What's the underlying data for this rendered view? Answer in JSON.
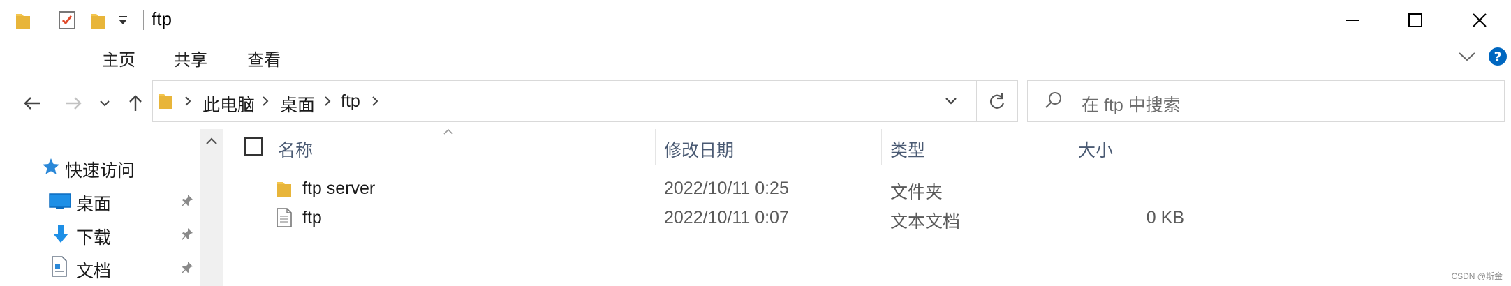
{
  "window": {
    "title": "ftp"
  },
  "ribbon": {
    "tabs": [
      "主页",
      "共享",
      "查看"
    ]
  },
  "address": {
    "crumbs": [
      "此电脑",
      "桌面",
      "ftp"
    ]
  },
  "search": {
    "placeholder": "在 ftp 中搜索"
  },
  "nav": {
    "quick_access": "快速访问",
    "items": [
      "桌面",
      "下载",
      "文档"
    ]
  },
  "columns": {
    "name": "名称",
    "date": "修改日期",
    "type": "类型",
    "size": "大小"
  },
  "files": [
    {
      "name": "ftp server",
      "date": "2022/10/11 0:25",
      "type": "文件夹",
      "size": "",
      "icon": "folder-icon"
    },
    {
      "name": "ftp",
      "date": "2022/10/11 0:07",
      "type": "文本文档",
      "size": "0 KB",
      "icon": "text-file-icon"
    }
  ],
  "watermark": "CSDN @斯金",
  "colors": {
    "folder": "#f4c64e",
    "accent": "#0067c0",
    "pin": "#8a8a8a"
  }
}
